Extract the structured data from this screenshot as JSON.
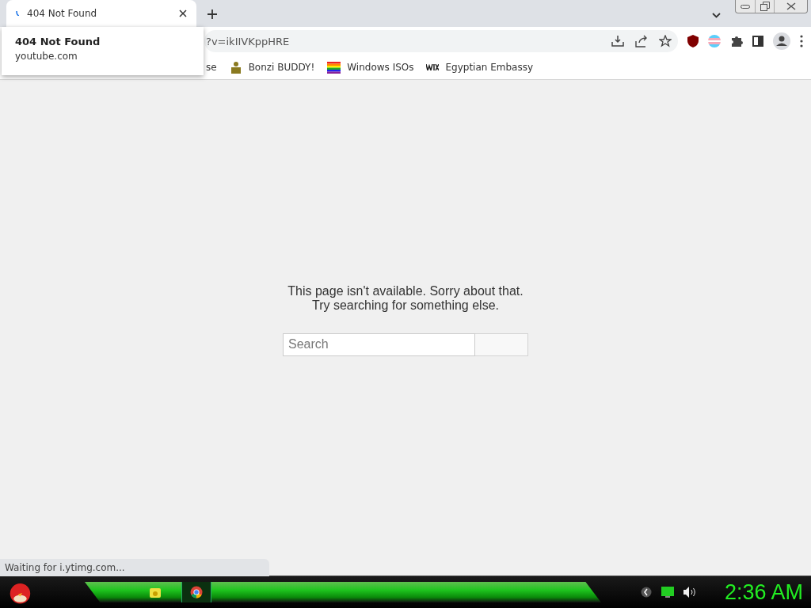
{
  "tabs": [
    {
      "title": "404 Not Found",
      "selected": true,
      "loading": true
    }
  ],
  "hover_card": {
    "title": "404 Not Found",
    "domain": "youtube.com"
  },
  "address_bar": {
    "url": "?v=ikIIVKppHRE"
  },
  "bookmarks": [
    {
      "label": "se",
      "kind": "plain"
    },
    {
      "label": "Bonzi BUDDY!",
      "kind": "buddy"
    },
    {
      "label": "Windows ISOs",
      "kind": "rainbow"
    },
    {
      "label": "Egyptian Embassy",
      "kind": "wix"
    }
  ],
  "page": {
    "message": [
      "This page isn't available. Sorry about that.",
      "Try searching for something else."
    ],
    "search": {
      "placeholder": "Search"
    }
  },
  "status_bubble": "Waiting for i.ytimg.com...",
  "taskbar": {
    "clock": "2:36 AM"
  }
}
